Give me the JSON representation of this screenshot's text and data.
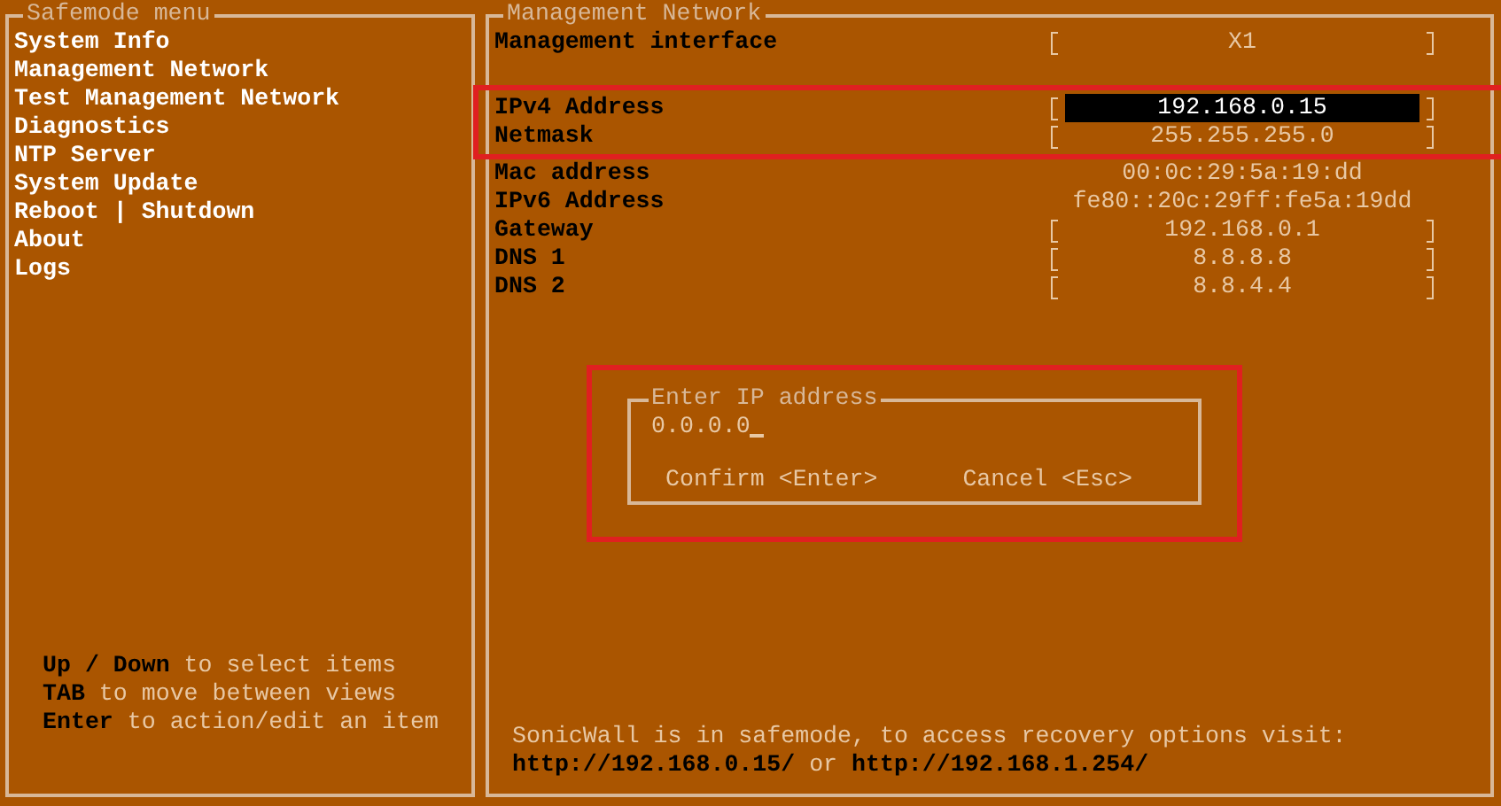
{
  "menu_panel": {
    "title": "Safemode menu",
    "items": [
      {
        "label": "System Info",
        "selected": false
      },
      {
        "label": "Management Network",
        "selected": false
      },
      {
        "label": "Test Management Network",
        "selected": false
      },
      {
        "label": "Diagnostics",
        "selected": false
      },
      {
        "label": "NTP Server",
        "selected": false
      },
      {
        "label": "System Update",
        "selected": false
      },
      {
        "label": "Reboot | Shutdown",
        "selected": false
      },
      {
        "label": "About",
        "selected": false
      },
      {
        "label": "Logs",
        "selected": false
      }
    ],
    "help": [
      "**Up / Down** to select items",
      "**TAB** to move between views",
      "**Enter** to action/edit an item"
    ]
  },
  "network_panel": {
    "title": "Management Network",
    "rows": [
      {
        "label": "Management interface",
        "value": "X1",
        "kind": "field",
        "selected": false,
        "highlighted": false
      },
      {
        "kind": "blank"
      },
      {
        "label": "IPv4 Address",
        "value": "192.168.0.15",
        "kind": "field",
        "selected": true,
        "highlighted": true
      },
      {
        "label": "Netmask",
        "value": "255.255.255.0",
        "kind": "field",
        "selected": false,
        "highlighted": true
      },
      {
        "label": "Mac address",
        "value": "00:0c:29:5a:19:dd",
        "kind": "info",
        "selected": false,
        "highlighted": false
      },
      {
        "label": "IPv6 Address",
        "value": "fe80::20c:29ff:fe5a:19dd",
        "kind": "info",
        "selected": false,
        "highlighted": false
      },
      {
        "label": "Gateway",
        "value": "192.168.0.1",
        "kind": "field",
        "selected": false,
        "highlighted": false
      },
      {
        "label": "DNS 1",
        "value": "8.8.8.8",
        "kind": "field",
        "selected": false,
        "highlighted": false
      },
      {
        "label": "DNS 2",
        "value": "8.8.4.4",
        "kind": "field",
        "selected": false,
        "highlighted": false
      }
    ],
    "dialog": {
      "title": "Enter IP address",
      "value": "0.0.0.0",
      "highlighted": true,
      "buttons": [
        "Confirm <Enter>",
        "Cancel <Esc>"
      ]
    },
    "message": "SonicWall is in safemode, to access recovery options visit:",
    "links": [
      "http://192.168.0.15/",
      "http://192.168.1.254/"
    ],
    "link_joiner": "or"
  }
}
